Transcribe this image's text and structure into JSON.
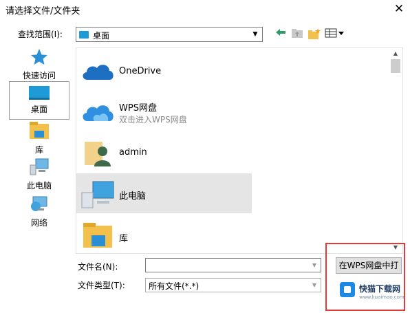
{
  "window": {
    "title": "请选择文件/文件夹"
  },
  "lookin": {
    "label": "查找范围(I):",
    "value": "桌面"
  },
  "places": [
    {
      "label": "快速访问"
    },
    {
      "label": "桌面"
    },
    {
      "label": "库"
    },
    {
      "label": "此电脑"
    },
    {
      "label": "网络"
    }
  ],
  "files": [
    {
      "name": "OneDrive",
      "sub": ""
    },
    {
      "name": "WPS网盘",
      "sub": "双击进入WPS网盘"
    },
    {
      "name": "admin",
      "sub": ""
    },
    {
      "name": "此电脑",
      "sub": ""
    },
    {
      "name": "库",
      "sub": ""
    }
  ],
  "filename": {
    "label": "文件名(N):",
    "value": ""
  },
  "filetype": {
    "label": "文件类型(T):",
    "value": "所有文件(*.*)"
  },
  "buttons": {
    "open": "在WPS网盘中打开",
    "close": "✕"
  },
  "watermark": {
    "text": "快猫下载网",
    "url": "www.kuaimao.com"
  },
  "colors": {
    "accent": "#1e9ad6",
    "highlight": "#e53935",
    "selection": "#e5e5e5"
  }
}
